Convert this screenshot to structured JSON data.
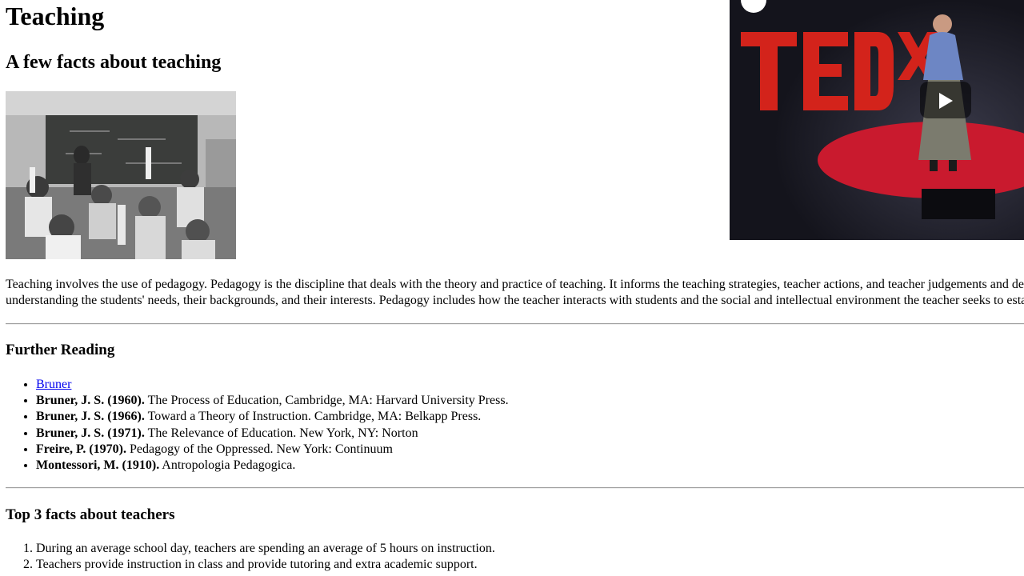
{
  "header": {
    "title": "Teaching",
    "subtitle": "A few facts about teaching"
  },
  "images": {
    "classroom_icon": "classroom-photo",
    "video_icon": "tedx-video-thumbnail",
    "play_icon": "play-icon"
  },
  "intro": {
    "line1": "Teaching involves the use of pedagogy. Pedagogy is the discipline that deals with the theory and practice of teaching. It informs the teaching strategies, teacher actions, and teacher judgements and decisions. I",
    "line2": "understanding the students' needs, their backgrounds, and their interests. Pedagogy includes how the teacher interacts with students and the social and intellectual environment the teacher seeks to establish."
  },
  "further_reading": {
    "heading": "Further Reading",
    "link": "Bruner",
    "items": [
      {
        "author": "Bruner, J. S. (1960).",
        "text": " The Process of Education, Cambridge, MA: Harvard University Press."
      },
      {
        "author": "Bruner, J. S. (1966).",
        "text": " Toward a Theory of Instruction. Cambridge, MA: Belkapp Press."
      },
      {
        "author": "Bruner, J. S. (1971).",
        "text": " The Relevance of Education. New York, NY: Norton"
      },
      {
        "author": "Freire, P. (1970).",
        "text": " Pedagogy of the Oppressed. New York: Continuum"
      },
      {
        "author": "Montessori, M. (1910).",
        "text": " Antropologia Pedagogica."
      }
    ]
  },
  "top_facts": {
    "heading": "Top 3 facts about teachers",
    "items": [
      "During an average school day, teachers are spending an average of 5 hours on instruction.",
      "Teachers provide instruction in class and provide tutoring and extra academic support."
    ]
  },
  "colors": {
    "link": "#0000ee",
    "tedx_red": "#e62b1e"
  }
}
